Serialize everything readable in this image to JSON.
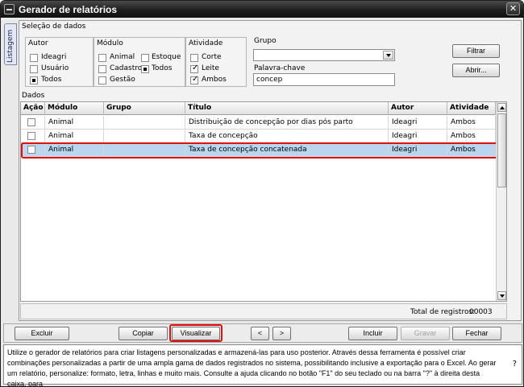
{
  "window": {
    "title": "Gerador de relatórios",
    "close_label": "✕"
  },
  "side_tab": {
    "label": "Listagem"
  },
  "selecao": {
    "label": "Seleção de dados",
    "autor": {
      "title": "Autor",
      "options": [
        {
          "label": "Ideagri",
          "state": "unchecked"
        },
        {
          "label": "Usuário",
          "state": "unchecked"
        },
        {
          "label": "Todos",
          "state": "filled"
        }
      ]
    },
    "modulo": {
      "title": "Módulo",
      "options": [
        {
          "label": "Animal",
          "state": "unchecked"
        },
        {
          "label": "Estoque",
          "state": "unchecked"
        },
        {
          "label": "Cadastro",
          "state": "unchecked"
        },
        {
          "label": "Todos",
          "state": "filled"
        },
        {
          "label": "Gestão",
          "state": "unchecked"
        }
      ]
    },
    "atividade": {
      "title": "Atividade",
      "options": [
        {
          "label": "Corte",
          "state": "unchecked"
        },
        {
          "label": "Leite",
          "state": "checked"
        },
        {
          "label": "Ambos",
          "state": "checked"
        }
      ]
    },
    "grupo": {
      "label": "Grupo",
      "value": ""
    },
    "palavra_chave": {
      "label": "Palavra-chave",
      "value": "concep"
    },
    "buttons": {
      "filtrar": "Filtrar",
      "abrir": "Abrir..."
    }
  },
  "dados": {
    "label": "Dados",
    "columns": [
      "Ação",
      "Módulo",
      "Grupo",
      "Título",
      "Autor",
      "Atividade"
    ],
    "rows": [
      {
        "modulo": "Animal",
        "grupo": "",
        "titulo": "Distribuição de concepção por dias pós parto",
        "autor": "Ideagri",
        "atividade": "Ambos"
      },
      {
        "modulo": "Animal",
        "grupo": "",
        "titulo": "Taxa de concepção",
        "autor": "Ideagri",
        "atividade": "Ambos"
      },
      {
        "modulo": "Animal",
        "grupo": "",
        "titulo": "Taxa de concepção concatenada",
        "autor": "Ideagri",
        "atividade": "Ambos"
      }
    ],
    "selected_row": 2,
    "total_label": "Total de registros:",
    "total_value": "00003"
  },
  "actions": {
    "excluir": "Excluir",
    "copiar": "Copiar",
    "visualizar": "Visualizar",
    "prev": "<",
    "next": ">",
    "incluir": "Incluir",
    "gravar": "Gravar",
    "fechar": "Fechar"
  },
  "help": {
    "text": "Utilize o gerador de relatórios para criar listagens personalizadas e armazená-las para uso posterior. Através dessa ferramenta é possível criar combinações personalizadas a partir de uma ampla gama de dados registrados no sistema, possibilitando inclusive a exportação para o Excel. Ao gerar um relatório, personalize: formato, letra, linhas e muito mais. Consulte a ajuda clicando no botão \"F1\" do seu teclado ou na barra \"?\" à direita desta caixa, para",
    "question": "?"
  },
  "colors": {
    "selected_row": "#b9d6ee",
    "highlight": "#e01010",
    "titlebar": "#1e1e1e"
  }
}
